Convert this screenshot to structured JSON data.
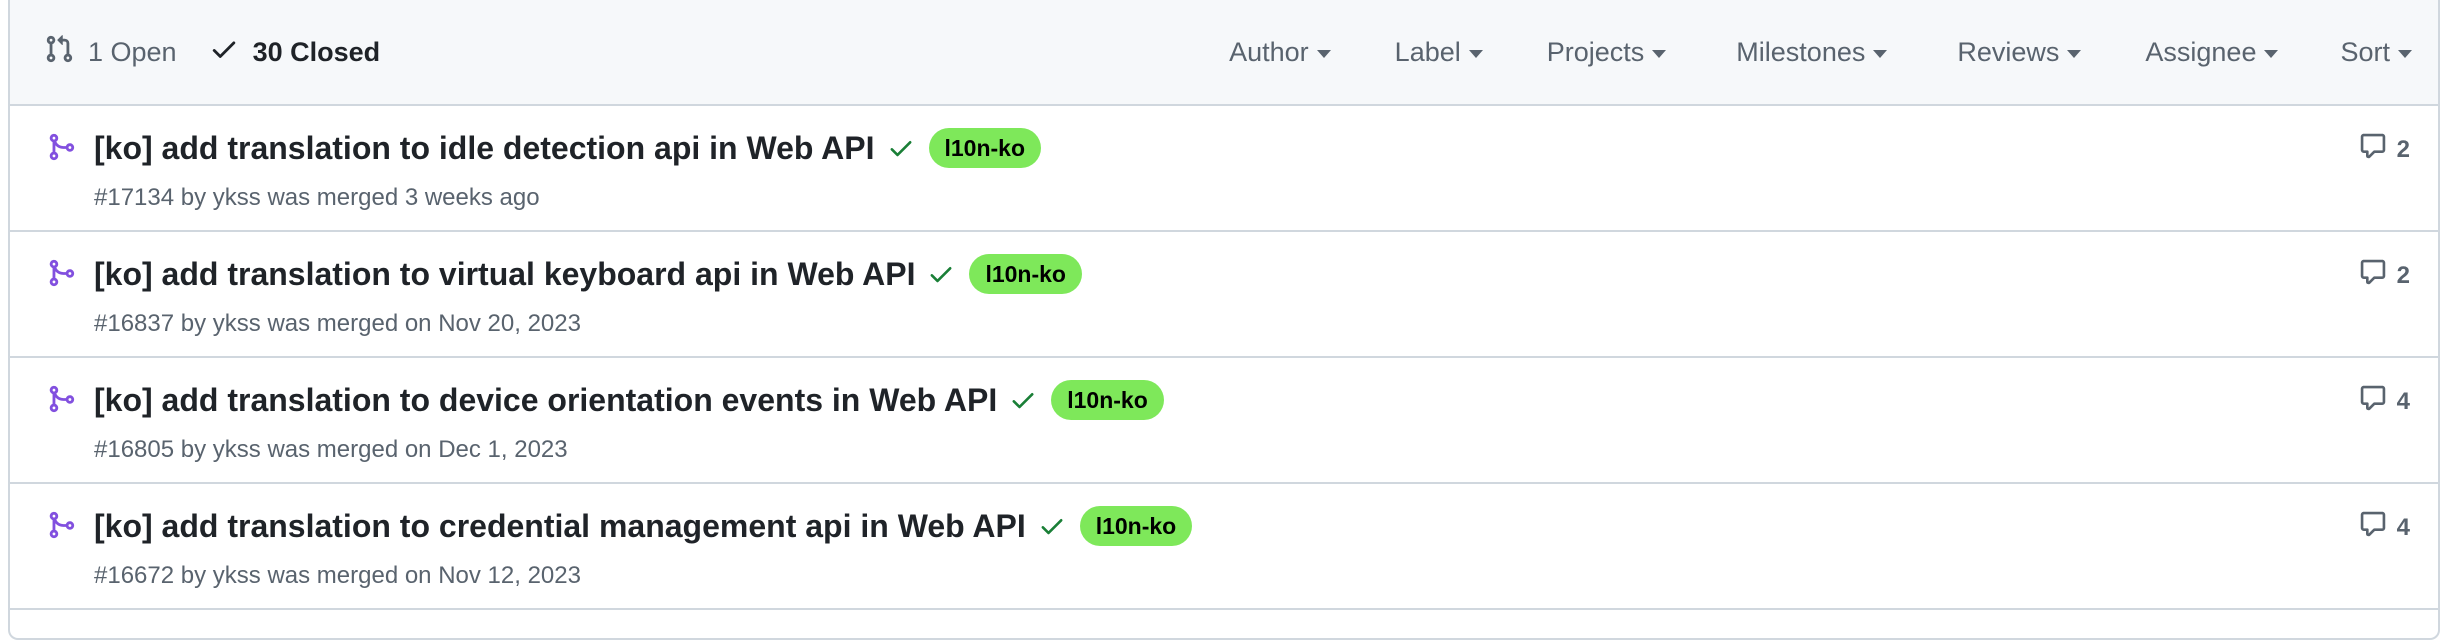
{
  "header": {
    "open_label": "1 Open",
    "closed_label": "30 Closed",
    "filters": [
      "Author",
      "Label",
      "Projects",
      "Milestones",
      "Reviews",
      "Assignee",
      "Sort"
    ]
  },
  "pull_requests": [
    {
      "title": "[ko] add translation to idle detection api in Web API",
      "label": "l10n-ko",
      "meta": "#17134 by ykss was merged 3 weeks ago",
      "comments": "2"
    },
    {
      "title": "[ko] add translation to virtual keyboard api in Web API",
      "label": "l10n-ko",
      "meta": "#16837 by ykss was merged on Nov 20, 2023",
      "comments": "2"
    },
    {
      "title": "[ko] add translation to device orientation events in Web API",
      "label": "l10n-ko",
      "meta": "#16805 by ykss was merged on Dec 1, 2023",
      "comments": "4"
    },
    {
      "title": "[ko] add translation to credential management api in Web API",
      "label": "l10n-ko",
      "meta": "#16672 by ykss was merged on Nov 12, 2023",
      "comments": "4"
    }
  ],
  "colors": {
    "label_bg": "#7ee85a",
    "merged_icon": "#8250df",
    "check": "#1a7f37"
  }
}
